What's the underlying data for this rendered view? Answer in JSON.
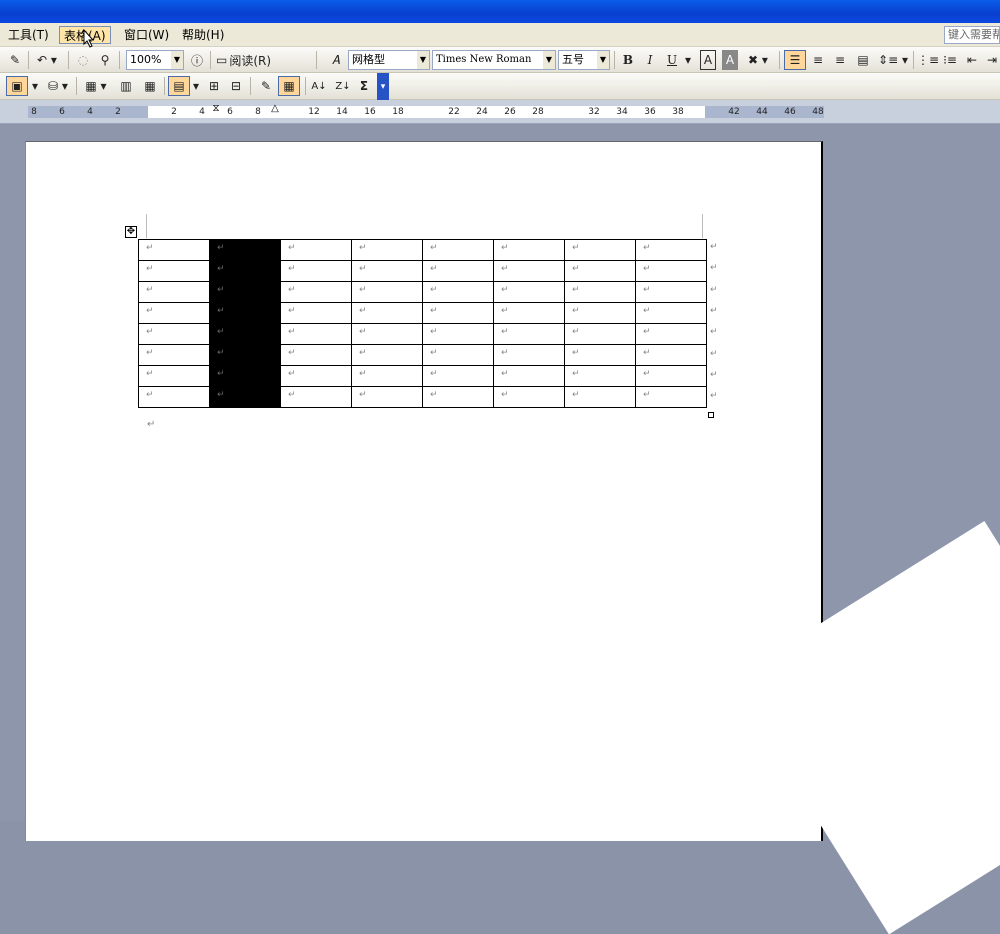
{
  "menu": {
    "items": [
      {
        "label": "工具(T)"
      },
      {
        "label": "表格(A)"
      },
      {
        "label": "窗口(W)"
      },
      {
        "label": "帮助(H)"
      }
    ],
    "help_box": "键入需要帮"
  },
  "toolbar1": {
    "zoom": "100%",
    "read_button": "阅读(R)",
    "style": "网格型",
    "font": "Times New Roman",
    "font_size": "五号",
    "bold": "B",
    "italic": "I",
    "underline": "U",
    "char_border": "A",
    "char_shading": "A"
  },
  "toolbar2": {
    "sort_asc": "A↓",
    "sort_desc": "Z↓",
    "autosum": "Σ"
  },
  "ruler": {
    "ticks": [
      "8",
      "6",
      "4",
      "2",
      "2",
      "4",
      "6",
      "8",
      "12",
      "14",
      "16",
      "18",
      "22",
      "24",
      "26",
      "28",
      "32",
      "34",
      "36",
      "38",
      "42",
      "44",
      "46",
      "48"
    ]
  },
  "document": {
    "paragraph_mark": "↵",
    "table": {
      "rows": 8,
      "cols": 8,
      "selected_column": 2,
      "cells": [
        [
          "↵",
          "↵",
          "↵",
          "↵",
          "↵",
          "↵",
          "↵",
          "↵"
        ],
        [
          "↵",
          "↵",
          "↵",
          "↵",
          "↵",
          "↵",
          "↵",
          "↵"
        ],
        [
          "↵",
          "↵",
          "↵",
          "↵",
          "↵",
          "↵",
          "↵",
          "↵"
        ],
        [
          "↵",
          "↵",
          "↵",
          "↵",
          "↵",
          "↵",
          "↵",
          "↵"
        ],
        [
          "↵",
          "↵",
          "↵",
          "↵",
          "↵",
          "↵",
          "↵",
          "↵"
        ],
        [
          "↵",
          "↵",
          "↵",
          "↵",
          "↵",
          "↵",
          "↵",
          "↵"
        ],
        [
          "↵",
          "↵",
          "↵",
          "↵",
          "↵",
          "↵",
          "↵",
          "↵"
        ],
        [
          "↵",
          "↵",
          "↵",
          "↵",
          "↵",
          "↵",
          "↵",
          "↵"
        ]
      ]
    }
  },
  "colors": {
    "title_bar": "#0a4fd8",
    "selection": "#000000",
    "active_menu": "#ffe6a8"
  }
}
